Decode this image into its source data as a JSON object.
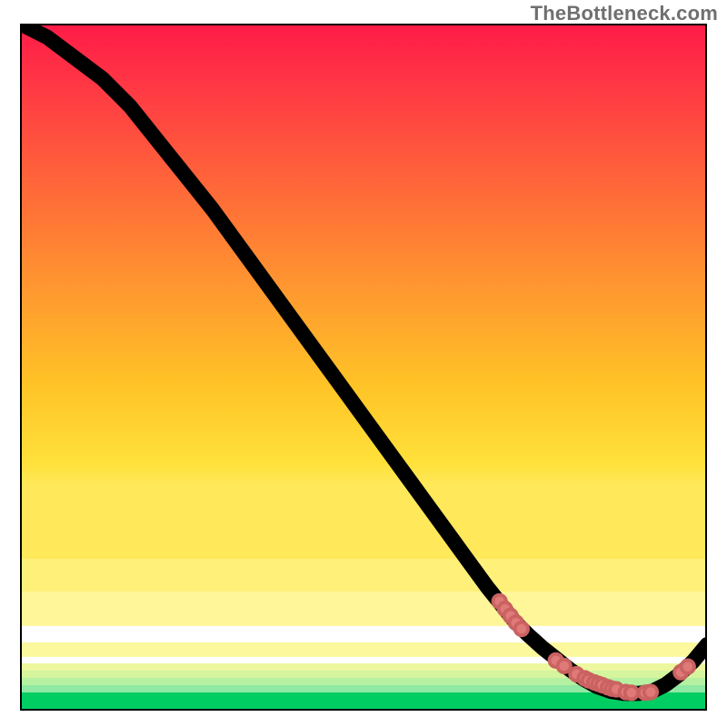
{
  "attribution": "TheBottleneck.com",
  "chart_data": {
    "type": "line",
    "title": "",
    "xlabel": "",
    "ylabel": "",
    "xlim": [
      0,
      100
    ],
    "ylim": [
      0,
      100
    ],
    "grid": false,
    "legend": false,
    "background": {
      "style": "vertical-gradient",
      "stops": [
        {
          "pos": 0.0,
          "color": "#ff1b48"
        },
        {
          "pos": 0.3,
          "color": "#ff6a38"
        },
        {
          "pos": 0.6,
          "color": "#ffc326"
        },
        {
          "pos": 0.82,
          "color": "#ffe85a"
        },
        {
          "pos": 0.87,
          "color": "#fff69a"
        },
        {
          "pos": 0.93,
          "color": "#fbf89d"
        },
        {
          "pos": 0.96,
          "color": "#b6f0a1"
        },
        {
          "pos": 0.975,
          "color": "#00cd62"
        },
        {
          "pos": 1.0,
          "color": "#00cd62"
        }
      ]
    },
    "series": [
      {
        "name": "bottleneck-curve",
        "style": "line",
        "color": "#000000",
        "x": [
          0,
          4,
          8,
          12,
          16,
          20,
          24,
          28,
          32,
          36,
          40,
          44,
          48,
          52,
          56,
          60,
          64,
          68,
          72,
          74,
          76,
          78,
          80,
          82,
          84,
          86,
          88,
          90,
          92,
          94,
          96,
          98,
          100
        ],
        "y": [
          100,
          98,
          95,
          92,
          88,
          83,
          78,
          73,
          67.5,
          62,
          56.5,
          51,
          45.5,
          40,
          34.5,
          29,
          23.5,
          18,
          13,
          11,
          9.2,
          7.6,
          6.0,
          4.6,
          3.5,
          2.8,
          2.5,
          2.5,
          2.8,
          3.8,
          5.3,
          7.2,
          9.6
        ]
      },
      {
        "name": "green-band-markers",
        "style": "scatter",
        "color": "#e07a78",
        "x": [
          69.8,
          70.6,
          71.4,
          72.2,
          73.0,
          78.0,
          79.2,
          81.0,
          82.2,
          82.8,
          83.6,
          84.2,
          84.8,
          85.6,
          86.2,
          86.8,
          88.2,
          89.0,
          91.0,
          91.8,
          96.2,
          97.2
        ],
        "y": [
          15.9,
          14.8,
          13.8,
          12.8,
          11.9,
          7.3,
          6.5,
          5.3,
          4.7,
          4.4,
          4.1,
          3.9,
          3.7,
          3.4,
          3.2,
          3.1,
          2.7,
          2.6,
          2.6,
          2.7,
          5.6,
          6.4
        ]
      }
    ],
    "notes": "No axis tick labels are rendered in the image; x and y are normalized 0–100 based on plot-box extents. The curve descends from top-left, bottoms out near x≈88–90 in the green band, then rises slightly toward the right edge. Salmon-colored scatter points cluster where the curve intersects the pale-yellow / green bands."
  }
}
